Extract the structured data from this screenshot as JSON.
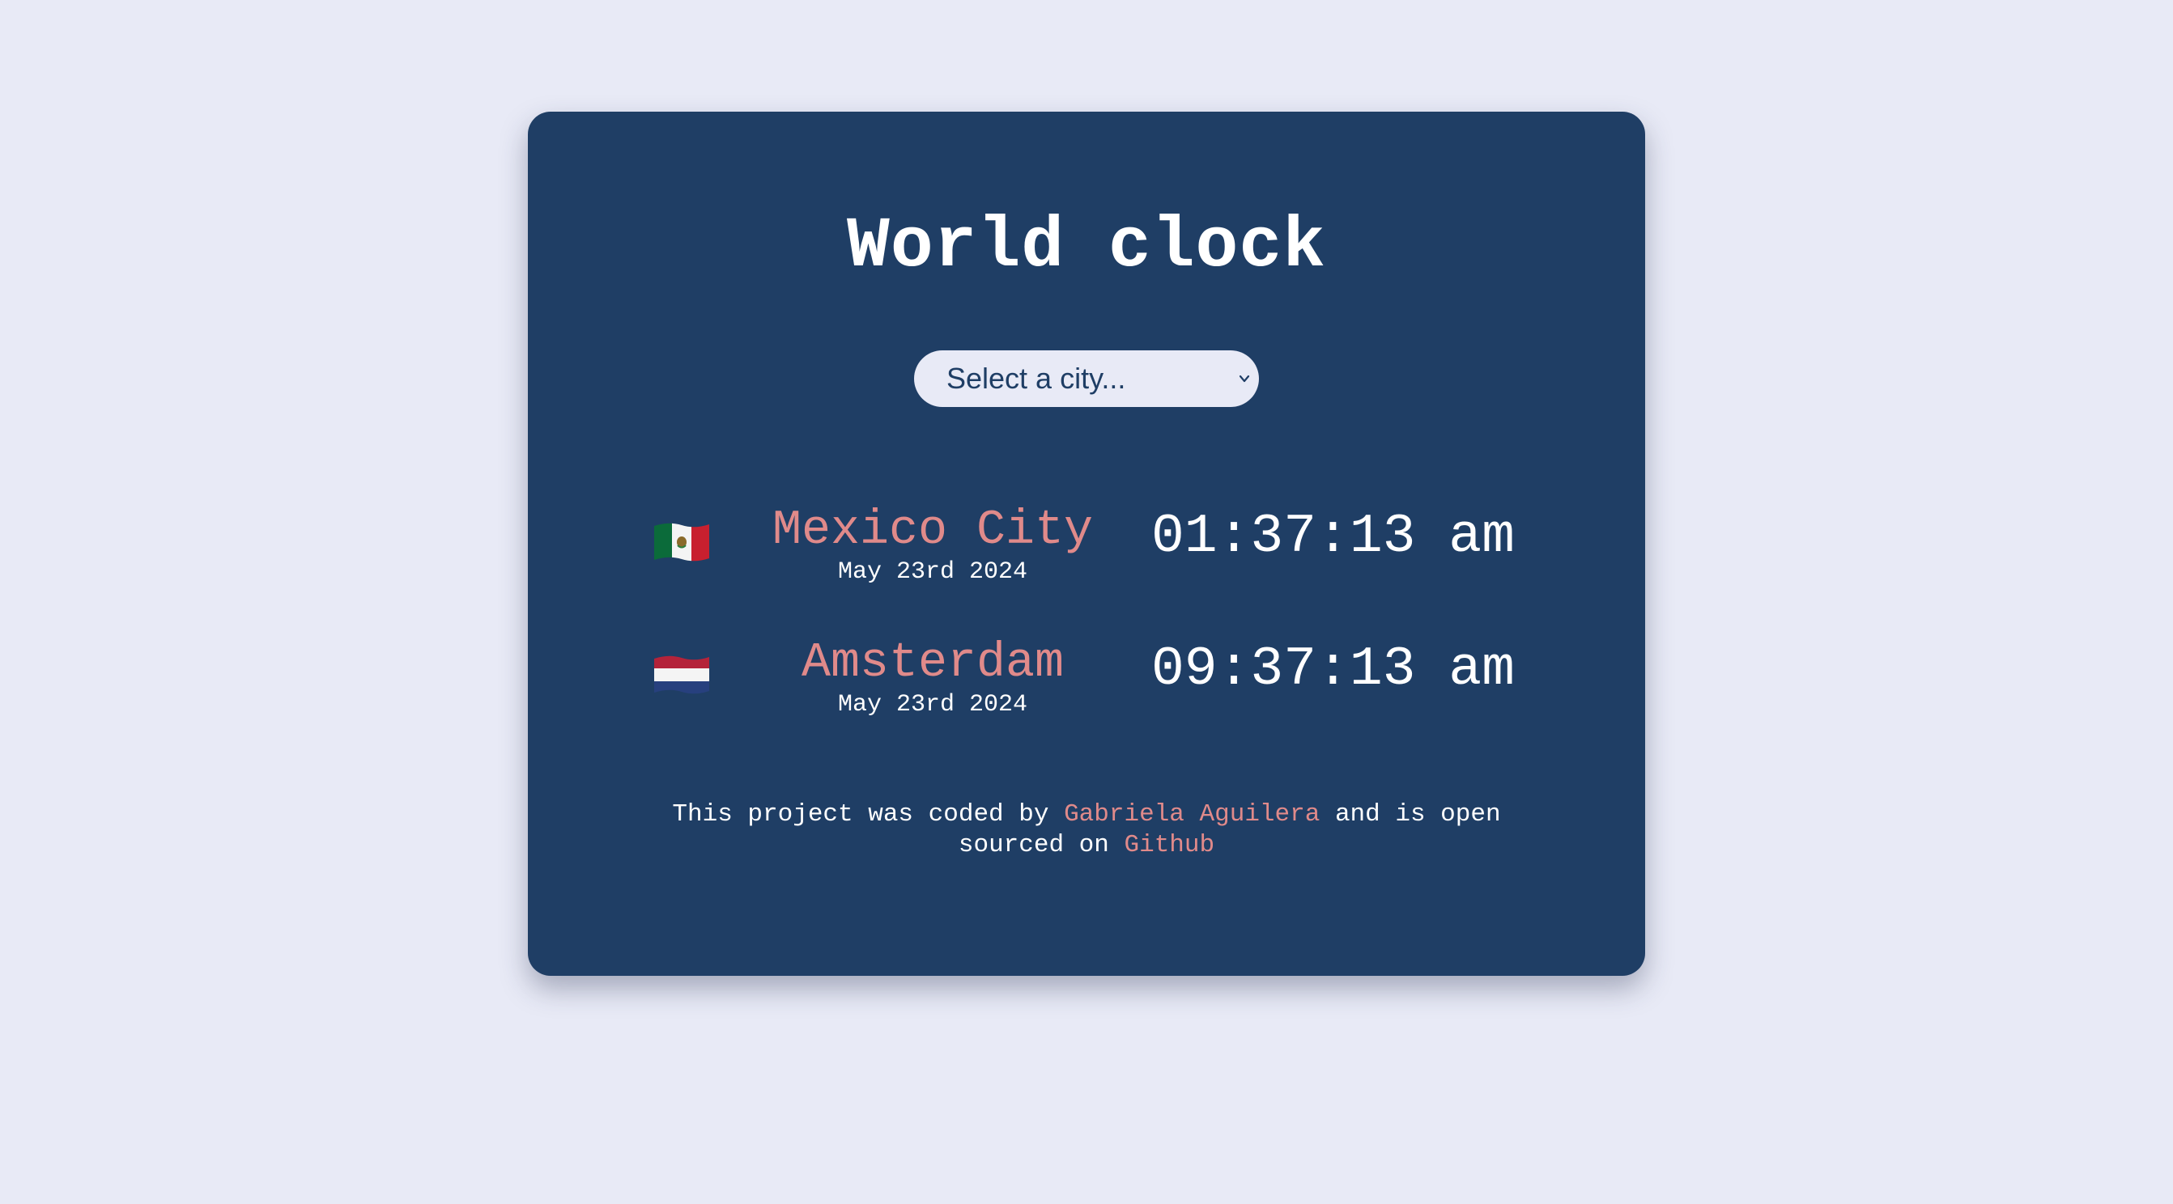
{
  "title": "World clock",
  "city_select": {
    "selected_label": "Select a city..."
  },
  "cities": [
    {
      "name": "Mexico City",
      "date": "May 23rd 2024",
      "time": "01:37:13 am",
      "flag_icon": "mexico-flag-icon"
    },
    {
      "name": "Amsterdam",
      "date": "May 23rd 2024",
      "time": "09:37:13 am",
      "flag_icon": "netherlands-flag-icon"
    }
  ],
  "footer": {
    "text_before": "This project was coded by ",
    "author_link": "Gabriela Aguilera",
    "text_middle": " and is open sourced on ",
    "github_link": "Github"
  },
  "colors": {
    "background": "#e8eaf6",
    "card": "#1f3e65",
    "accent": "#e08a8a",
    "text": "#ffffff"
  }
}
